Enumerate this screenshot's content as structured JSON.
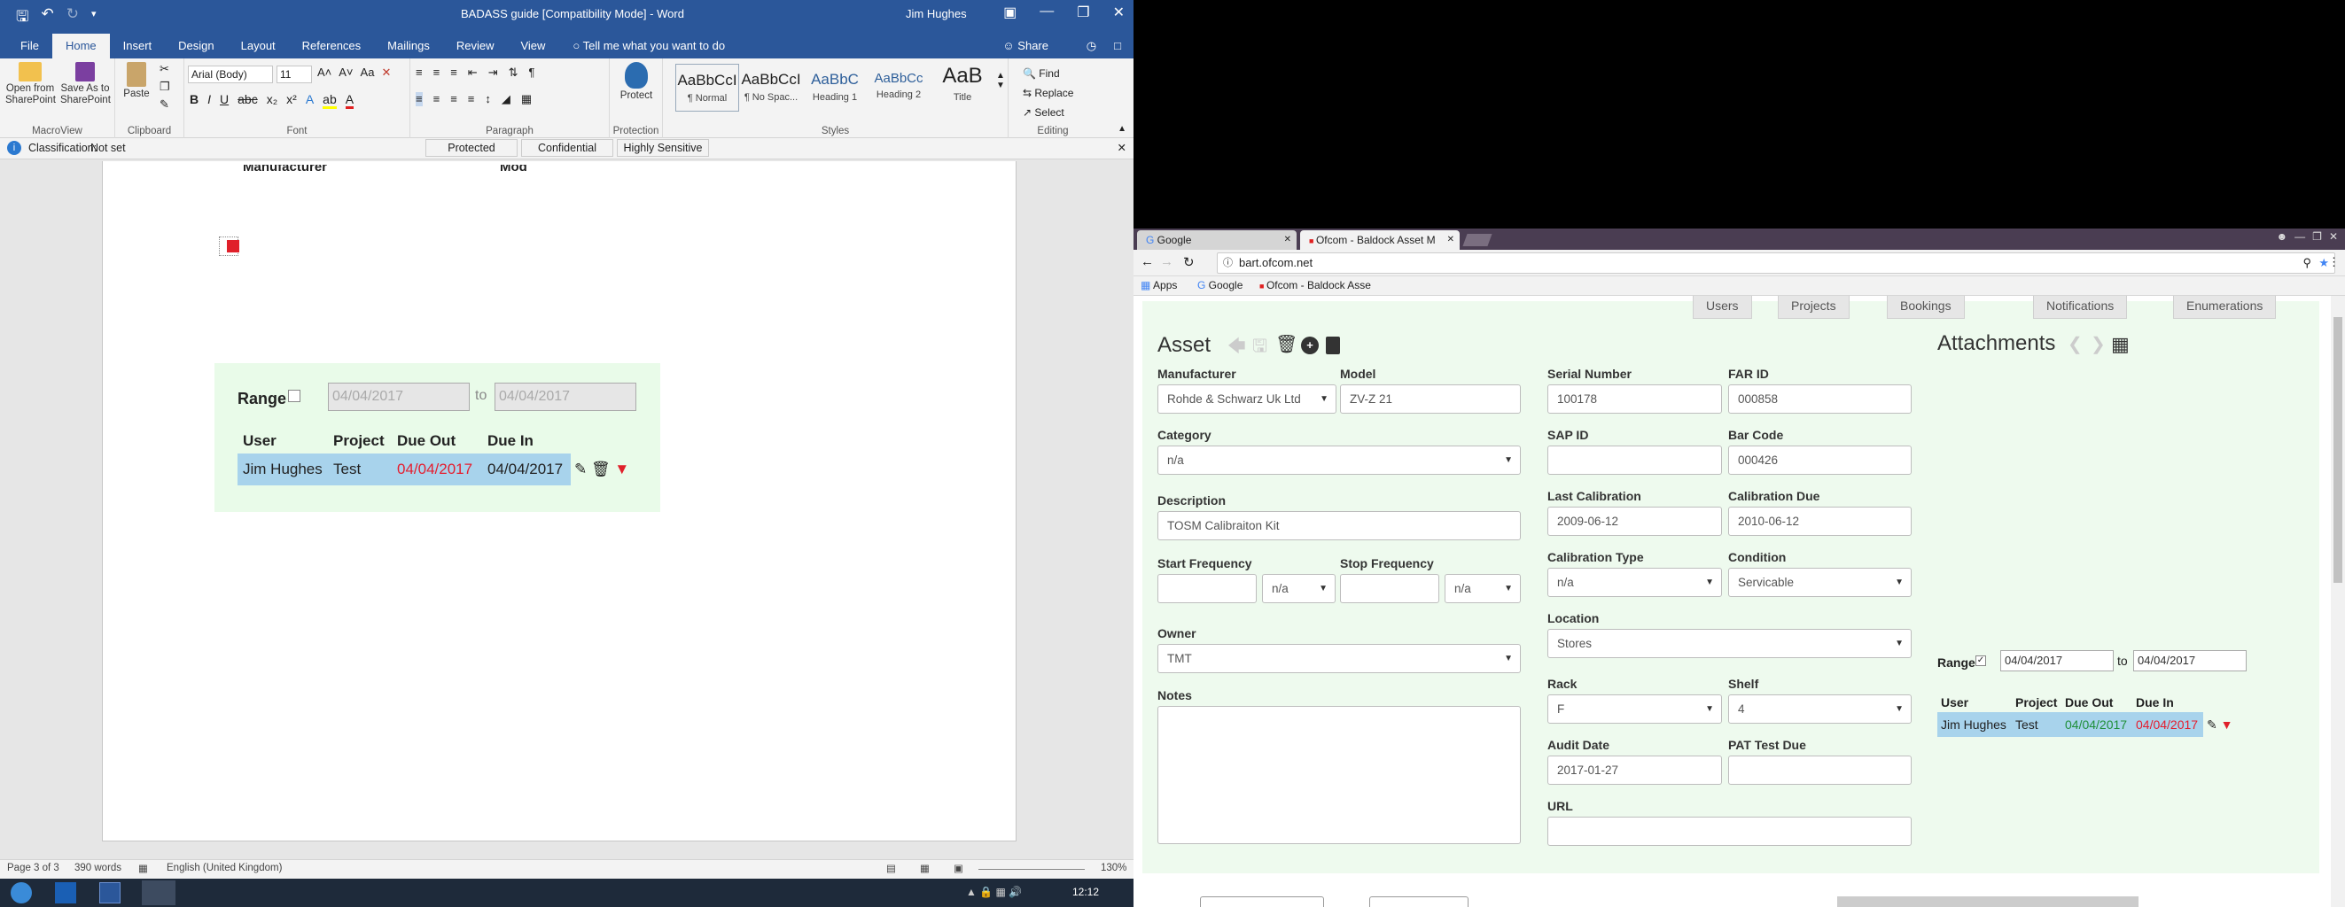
{
  "word": {
    "title": "BADASS guide [Compatibility Mode] - Word",
    "user": "Jim Hughes",
    "tabs": [
      "File",
      "Home",
      "Insert",
      "Design",
      "Layout",
      "References",
      "Mailings",
      "Review",
      "View"
    ],
    "tell_me": "Tell me what you want to do",
    "share": "Share",
    "ribbon": {
      "open_from_sp": "Open from SharePoint",
      "save_as_sp": "Save As to SharePoint",
      "macroview": "MacroView",
      "paste": "Paste",
      "clipboard": "Clipboard",
      "font_name": "Arial (Body)",
      "font_size": "11",
      "font": "Font",
      "paragraph": "Paragraph",
      "protect": "Protect",
      "protection": "Protection",
      "styles": [
        {
          "preview": "AaBbCcI",
          "name": "¶ Normal"
        },
        {
          "preview": "AaBbCcI",
          "name": "¶ No Spac..."
        },
        {
          "preview": "AaBbC",
          "name": "Heading 1"
        },
        {
          "preview": "AaBbCc",
          "name": "Heading 2"
        },
        {
          "preview": "AaB",
          "name": "Title"
        }
      ],
      "styles_label": "Styles",
      "find": "Find",
      "replace": "Replace",
      "select": "Select",
      "editing": "Editing"
    },
    "classification": {
      "label": "Classification:",
      "value": "Not set",
      "options": [
        "Protected",
        "Confidential",
        "Highly Sensitive"
      ]
    },
    "doc": {
      "partial_headers": [
        "Manufacturer",
        "Mod"
      ],
      "range_label": "Range",
      "date_from": "04/04/2017",
      "to": "to",
      "date_to": "04/04/2017",
      "columns": [
        "User",
        "Project",
        "Due Out",
        "Due In"
      ],
      "row": {
        "user": "Jim Hughes",
        "project": "Test",
        "due_out": "04/04/2017",
        "due_in": "04/04/2017"
      }
    },
    "status": {
      "page": "Page 3 of 3",
      "words": "390 words",
      "language": "English (United Kingdom)",
      "zoom": "130%"
    },
    "clock": "12:12"
  },
  "browser": {
    "tabs": [
      {
        "label": "Google"
      },
      {
        "label": "Ofcom - Baldock Asset M"
      }
    ],
    "url": "bart.ofcom.net",
    "bookmarks": [
      "Apps",
      "Google",
      "Ofcom - Baldock Asse"
    ],
    "nav_tabs": [
      "Users",
      "Projects",
      "Bookings",
      "Notifications",
      "Enumerations"
    ],
    "asset": {
      "heading": "Asset",
      "manufacturer_label": "Manufacturer",
      "manufacturer": "Rohde & Schwarz Uk Ltd",
      "model_label": "Model",
      "model": "ZV-Z 21",
      "serial_label": "Serial Number",
      "serial": "100178",
      "far_label": "FAR ID",
      "far": "000858",
      "category_label": "Category",
      "category": "n/a",
      "sap_label": "SAP ID",
      "sap": "",
      "barcode_label": "Bar Code",
      "barcode": "000426",
      "description_label": "Description",
      "description": "TOSM Calibraiton Kit",
      "last_cal_label": "Last Calibration",
      "last_cal": "2009-06-12",
      "cal_due_label": "Calibration Due",
      "cal_due": "2010-06-12",
      "start_freq_label": "Start Frequency",
      "start_freq": "",
      "start_unit": "n/a",
      "stop_freq_label": "Stop Frequency",
      "stop_freq": "",
      "stop_unit": "n/a",
      "cal_type_label": "Calibration Type",
      "cal_type": "n/a",
      "condition_label": "Condition",
      "condition": "Servicable",
      "location_label": "Location",
      "location": "Stores",
      "owner_label": "Owner",
      "owner": "TMT",
      "rack_label": "Rack",
      "rack": "F",
      "shelf_label": "Shelf",
      "shelf": "4",
      "notes_label": "Notes",
      "notes": "",
      "audit_label": "Audit Date",
      "audit": "2017-01-27",
      "pat_label": "PAT Test Due",
      "pat": "",
      "url_label": "URL",
      "url": ""
    },
    "attachments": {
      "heading": "Attachments",
      "range_label": "Range",
      "date_from": "04/04/2017",
      "to": "to",
      "date_to": "04/04/2017",
      "columns": [
        "User",
        "Project",
        "Due Out",
        "Due In"
      ],
      "row": {
        "user": "Jim Hughes",
        "project": "Test",
        "due_out": "04/04/2017",
        "due_in": "04/04/2017"
      }
    }
  }
}
